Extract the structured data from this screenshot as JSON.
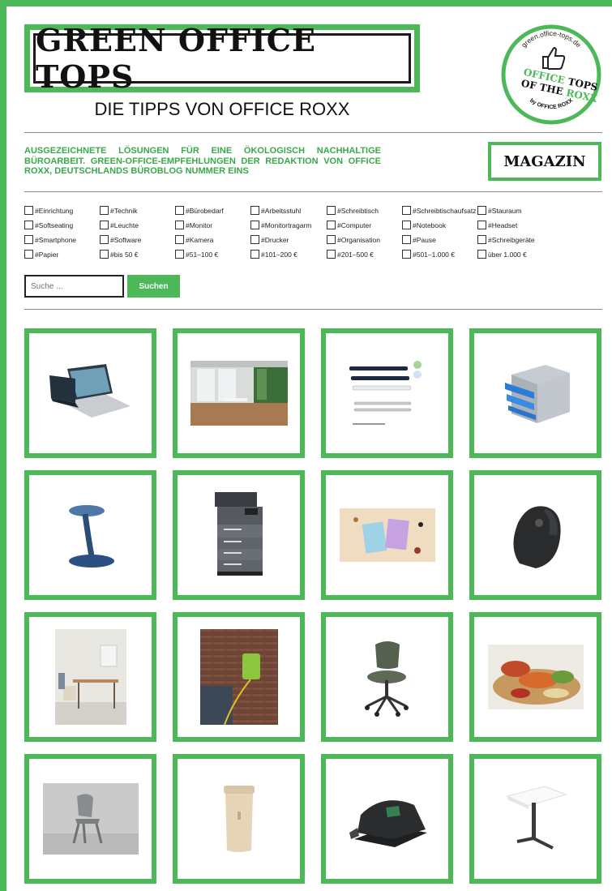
{
  "header": {
    "logo_text": "GREEN OFFICE TOPS",
    "tagline": "DIE TIPPS VON OFFICE ROXX",
    "badge": {
      "domain": "green.office-tops.de",
      "line1a": "OFFICE",
      "line1b": "TOPS",
      "line2a": "OF THE",
      "line2b": "ROXX",
      "by": "by OFFICE ROXX"
    }
  },
  "intro": "AUSGEZEICHNETE LÖSUNGEN FÜR EINE ÖKOLOGISCH NACHHALTIGE BÜROARBEIT. GREEN-OFFICE-EMPFEHLUNGEN DER REDAKTION VON OFFICE ROXX, DEUTSCHLANDS BÜROBLOG NUMMER EINS",
  "magazin_label": "MAGAZIN",
  "tags": [
    [
      "#Einrichtung",
      "#Technik",
      "#Bürobedarf",
      "#Arbeitsstuhl",
      "#Schreibtisch",
      "#Schreibtischaufsatz",
      "#Stauraum"
    ],
    [
      "#Softseating",
      "#Leuchte",
      "#Monitor",
      "#Monitortragarm",
      "#Computer",
      "#Notebook",
      "#Headset"
    ],
    [
      "#Smartphone",
      "#Software",
      "#Kamera",
      "#Drucker",
      "#Organisation",
      "#Pause",
      "#Schreibgeräte"
    ],
    [
      "#Papier",
      "#bis 50 €",
      "#51–100 €",
      "#101–200 €",
      "#201–500 €",
      "#501–1.000 €",
      "über 1.000 €"
    ]
  ],
  "search": {
    "placeholder": "Suche ...",
    "button": "Suchen"
  },
  "products": [
    {
      "icon": "laptop-icon"
    },
    {
      "icon": "office-room-icon"
    },
    {
      "icon": "pens-icon"
    },
    {
      "icon": "drawer-box-icon"
    },
    {
      "icon": "stool-icon"
    },
    {
      "icon": "printer-icon"
    },
    {
      "icon": "snack-packs-icon"
    },
    {
      "icon": "vertical-mouse-icon"
    },
    {
      "icon": "desk-scene-icon"
    },
    {
      "icon": "ev-charger-icon"
    },
    {
      "icon": "office-chair-icon"
    },
    {
      "icon": "food-platter-icon"
    },
    {
      "icon": "chair-grey-icon"
    },
    {
      "icon": "cup-icon"
    },
    {
      "icon": "hole-punch-icon"
    },
    {
      "icon": "standing-desk-icon"
    }
  ],
  "colors": {
    "brand_green": "#4cb857",
    "text_dark": "#111111"
  }
}
